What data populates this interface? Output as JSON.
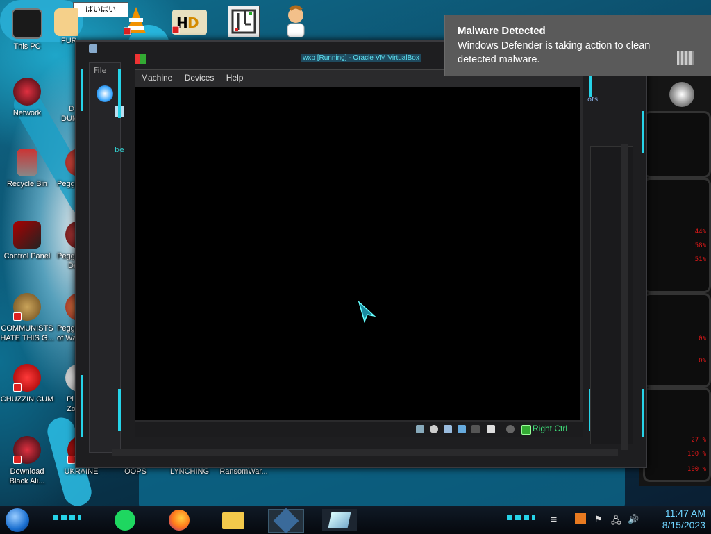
{
  "desktop": {
    "tooltip": "ばいばい",
    "icons": [
      {
        "label": "This PC"
      },
      {
        "label": "FUR"
      },
      {
        "label": "Network"
      },
      {
        "label": "D"
      },
      {
        "label": "DUM"
      },
      {
        "label": "Recycle Bin"
      },
      {
        "label": "Peggl"
      },
      {
        "label": "Control Panel"
      },
      {
        "label": "Peggl"
      },
      {
        "label": "De"
      },
      {
        "label": "COMMUNISTS HATE THIS G..."
      },
      {
        "label": "Peggl"
      },
      {
        "label": "of Wa"
      },
      {
        "label": "CHUZZIN CUM"
      },
      {
        "label": "Pi"
      },
      {
        "label": "Zo"
      },
      {
        "label": "Download Black Ali..."
      },
      {
        "label": "UKRAINE"
      },
      {
        "label": "OOPS"
      },
      {
        "label": "LYNCHING"
      },
      {
        "label": "RansomWar..."
      }
    ]
  },
  "hud": {
    "values": [
      "44%",
      "58%",
      "51%",
      "0%",
      "0%",
      "27 %",
      "100 %",
      "100 %"
    ]
  },
  "vbox": {
    "title": "wxp [Running] - Oracle VM VirtualBox",
    "side_file_menu": "File",
    "side_labels": [
      "be"
    ],
    "peek_label": "ots",
    "menu": [
      "Machine",
      "Devices",
      "Help"
    ],
    "host_key": "Right Ctrl"
  },
  "toast": {
    "title": "Malware Detected",
    "body": "Windows Defender is taking action to clean detected malware."
  },
  "taskbar": {
    "time": "11:47 AM",
    "date": "8/15/2023"
  },
  "colors": {
    "accent_cyan": "#26d3e8",
    "hud_red": "#e01818",
    "clock": "#6fd4ff",
    "toast_bg": "#5a5a5a"
  }
}
